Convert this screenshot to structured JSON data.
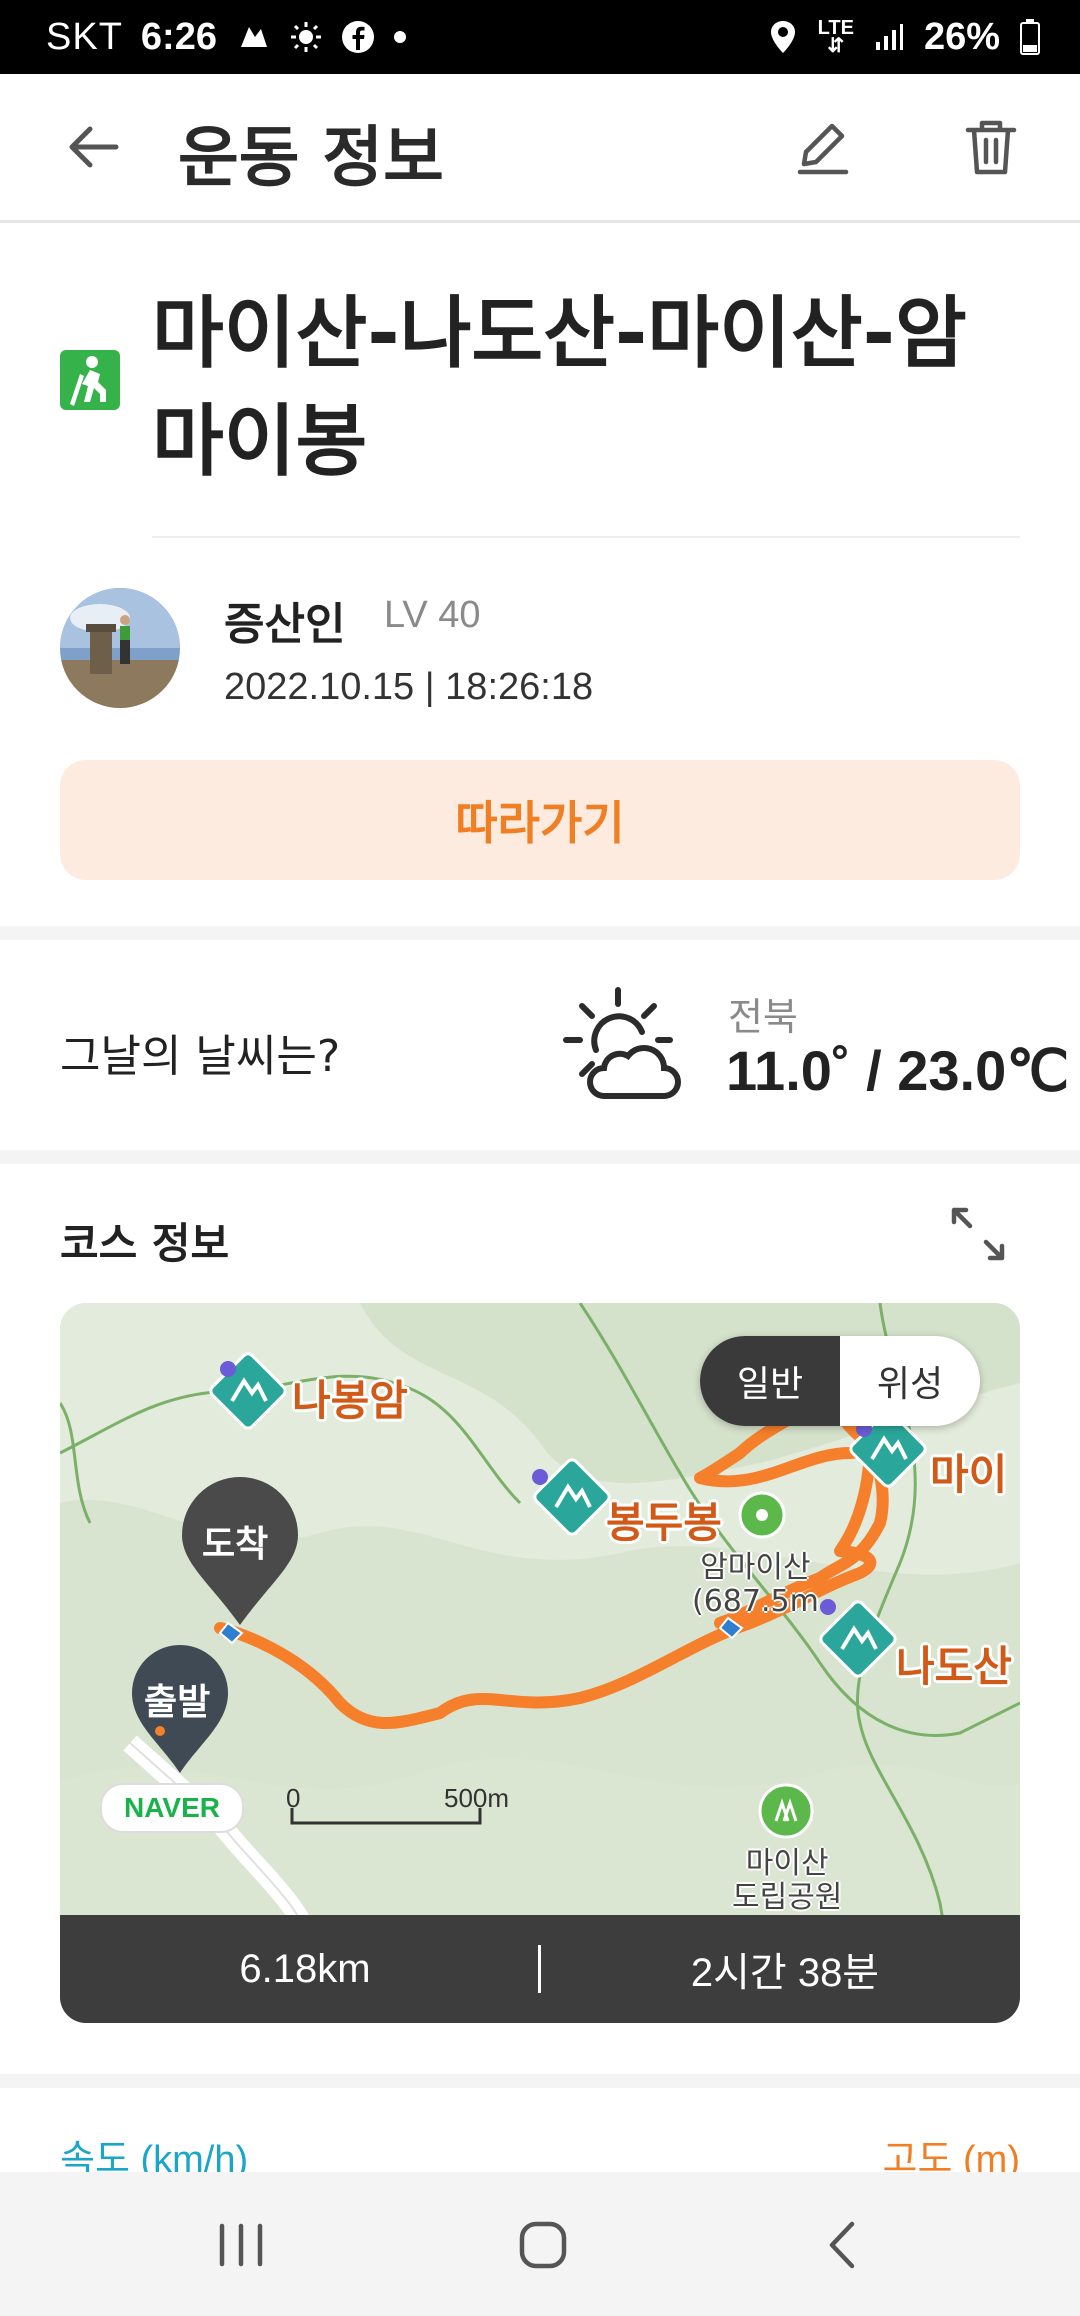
{
  "status_bar": {
    "carrier": "SKT",
    "time": "6:26",
    "network": "LTE",
    "battery": "26%"
  },
  "header": {
    "title": "운동 정보"
  },
  "activity": {
    "title": "마이산-나도산-마이산-암마이봉",
    "user_name": "증산인",
    "level": "LV 40",
    "datetime": "2022.10.15 | 18:26:18",
    "follow_label": "따라가기"
  },
  "weather": {
    "label": "그날의 날씨는?",
    "region": "전북",
    "temperature": "11.0˚ / 23.0℃"
  },
  "course": {
    "label": "코스 정보",
    "map_modes": [
      "일반",
      "위성"
    ],
    "selected_mode": "일반",
    "peaks": [
      "나봉암",
      "봉두봉",
      "마이",
      "나도산"
    ],
    "places": [
      "암마이산\n(687.5m",
      "마이산\n도립공원"
    ],
    "pins": {
      "arrive": "도착",
      "start": "출발"
    },
    "map_brand": "NAVER",
    "scale": {
      "start": "0",
      "end": "500m"
    },
    "distance": "6.18km",
    "duration": "2시간 38분"
  },
  "charts": {
    "speed_label": "속도 (km/h)",
    "altitude_label": "고도 (m)"
  },
  "colors": {
    "accent": "#f07e22",
    "follow_bg": "#fdebdf",
    "route": "#f57f2a",
    "peak_marker": "#2aa79a",
    "speed": "#1aa6c8"
  }
}
